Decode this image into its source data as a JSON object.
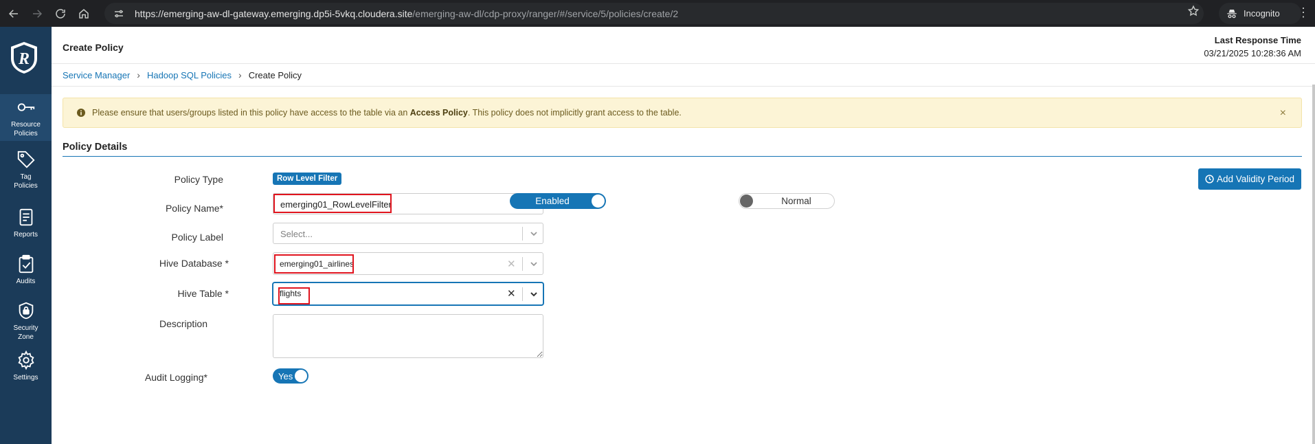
{
  "browser": {
    "url_host": "https://emerging-aw-dl-gateway.emerging.dp5i-5vkq.cloudera.site",
    "url_path": "/emerging-aw-dl/cdp-proxy/ranger/#/service/5/policies/create/2",
    "incognito_label": "Incognito"
  },
  "sidebar": {
    "items": [
      {
        "label_line1": "Resource",
        "label_line2": "Policies",
        "icon": "key-icon"
      },
      {
        "label_line1": "Tag",
        "label_line2": "Policies",
        "icon": "tag-icon"
      },
      {
        "label_line1": "Reports",
        "label_line2": "",
        "icon": "report-icon"
      },
      {
        "label_line1": "Audits",
        "label_line2": "",
        "icon": "clipboard-check-icon"
      },
      {
        "label_line1": "Security",
        "label_line2": "Zone",
        "icon": "shield-lock-icon"
      },
      {
        "label_line1": "Settings",
        "label_line2": "",
        "icon": "gear-icon"
      }
    ]
  },
  "header": {
    "title": "Create Policy",
    "last_response_label": "Last Response Time",
    "last_response_time": "03/21/2025 10:28:36 AM"
  },
  "breadcrumb": {
    "items": [
      "Service Manager",
      "Hadoop SQL Policies",
      "Create Policy"
    ]
  },
  "alert": {
    "text_before": "Please ensure that users/groups listed in this policy have access to the table via an ",
    "bold_text": "Access Policy",
    "text_after": ". This policy does not implicitly grant access to the table.",
    "close": "×"
  },
  "section": {
    "title": "Policy Details"
  },
  "form": {
    "policy_type_label": "Policy Type",
    "policy_type_badge": "Row Level Filter",
    "add_validity_label": "Add Validity Period",
    "policy_name_label": "Policy Name*",
    "policy_name_value": "emerging01_RowLevelFilter",
    "enabled_label": "Enabled",
    "normal_label": "Normal",
    "policy_label_label": "Policy Label",
    "policy_label_placeholder": "Select...",
    "hive_database_label": "Hive Database *",
    "hive_database_value": "emerging01_airlines",
    "hive_table_label": "Hive Table *",
    "hive_table_value": "flights",
    "description_label": "Description",
    "audit_logging_label": "Audit Logging*",
    "audit_logging_value": "Yes"
  },
  "colors": {
    "sidebar_bg": "#1b3b59",
    "primary": "#1675b5",
    "alert_bg": "#fcf4d6",
    "highlight_red": "#e0141e"
  }
}
